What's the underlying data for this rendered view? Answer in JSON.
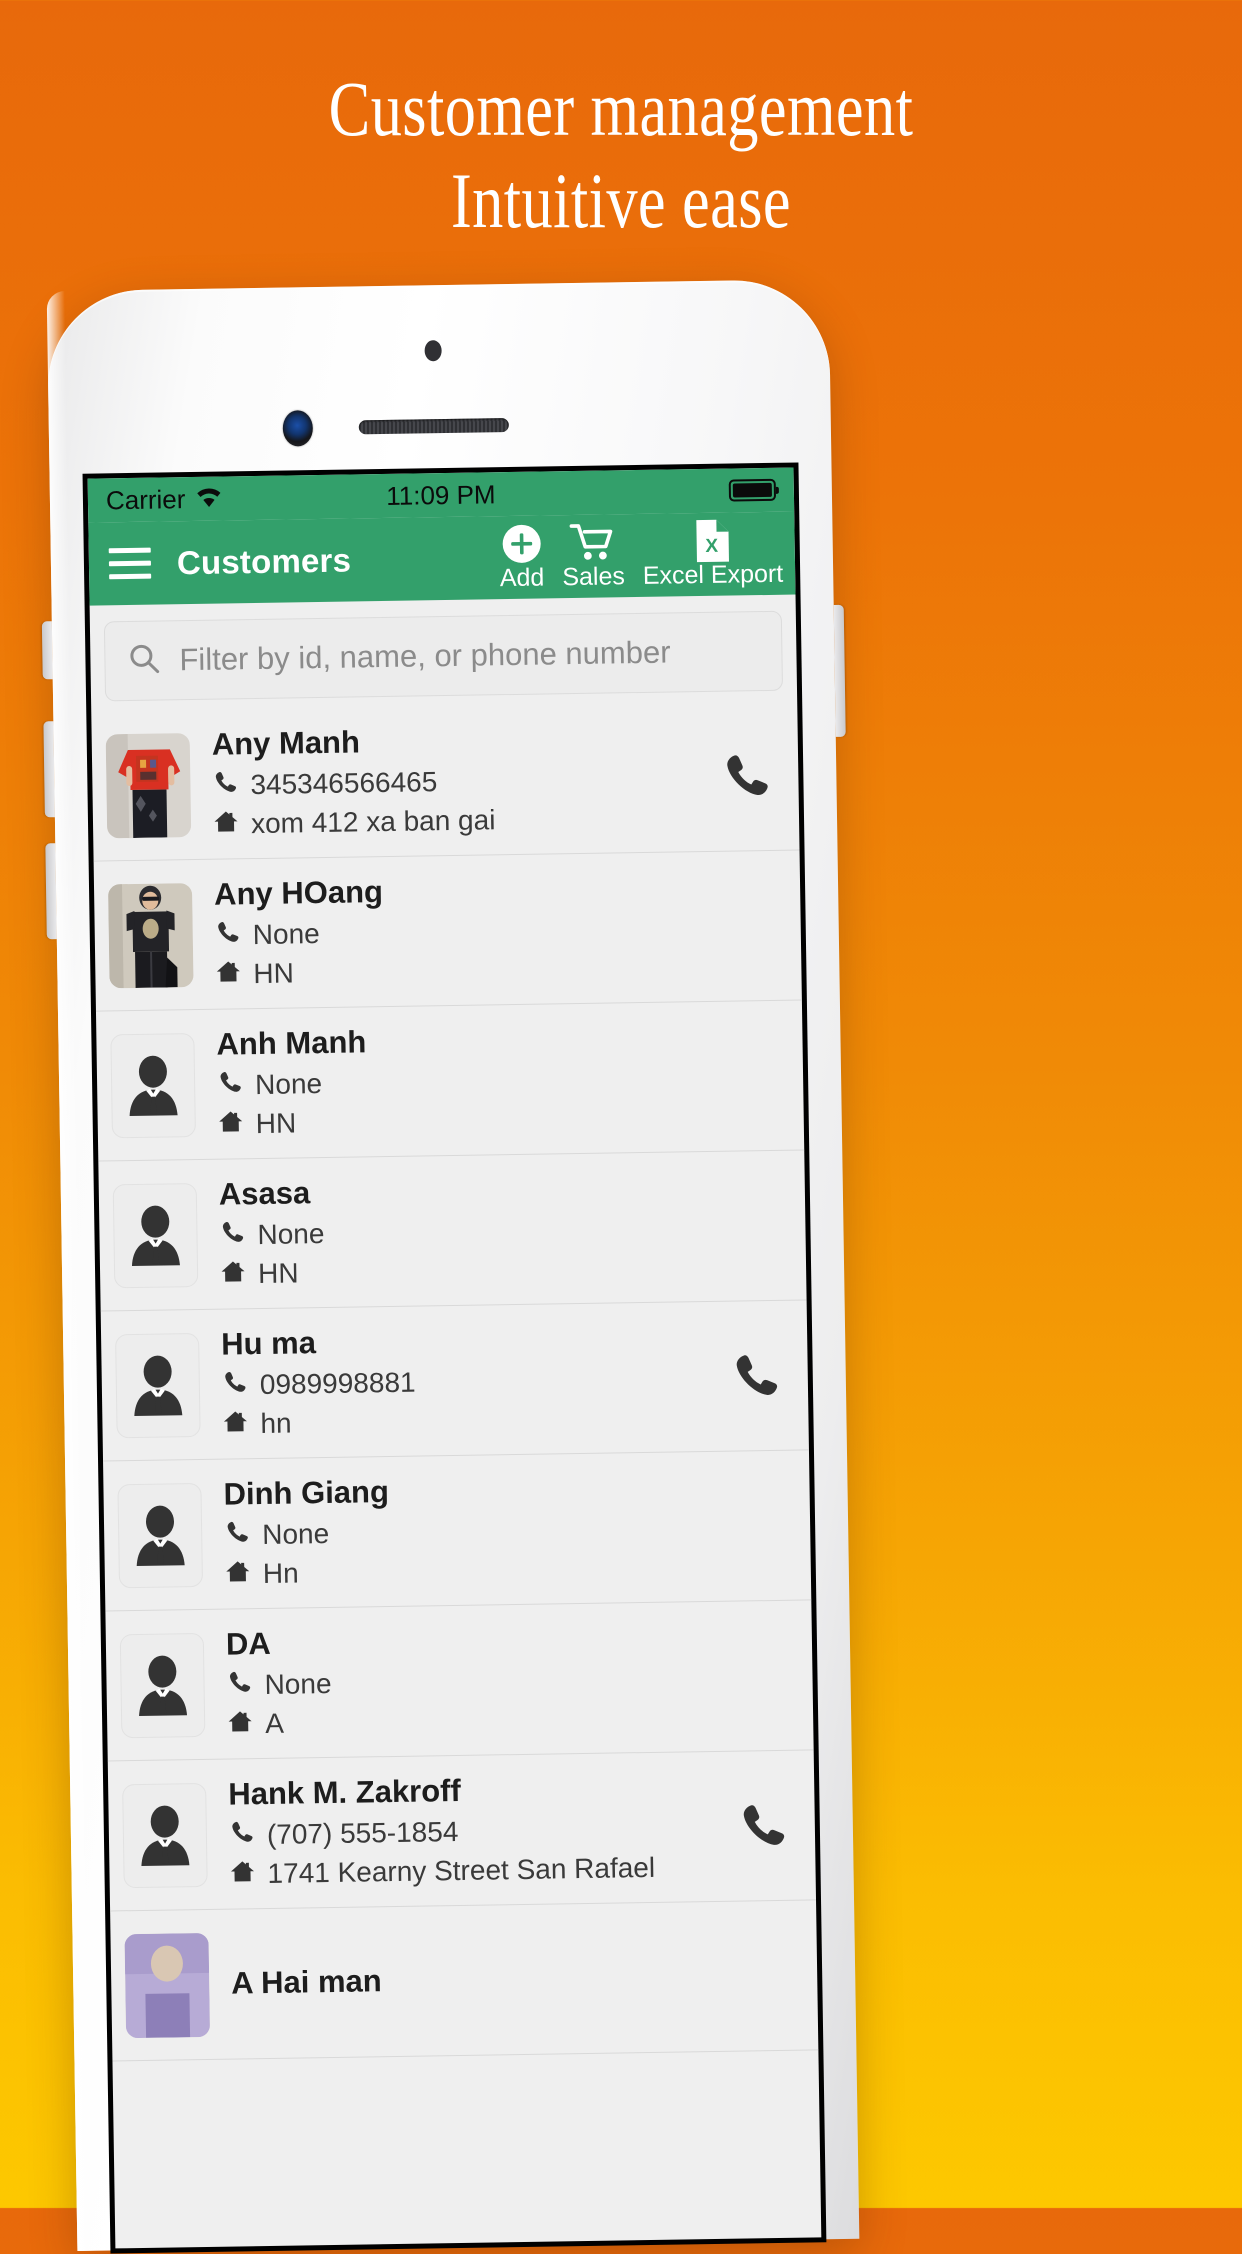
{
  "promo": {
    "line1": "Customer management",
    "line2": "Intuitive ease",
    "text_color": "#ffffff",
    "bg_top": "#e8690b",
    "bg_bottom": "#fdc800"
  },
  "status_bar": {
    "carrier": "Carrier",
    "wifi_icon": "wifi-icon",
    "time": "11:09 PM",
    "battery_icon": "battery-full-icon",
    "bg_color": "#33a06b"
  },
  "app_bar": {
    "menu_icon": "hamburger-menu-icon",
    "title": "Customers",
    "bg_color": "#33a06b",
    "actions": [
      {
        "label": "Add",
        "icon": "plus-circle-icon"
      },
      {
        "label": "Sales",
        "icon": "shopping-cart-icon"
      },
      {
        "label": "Excel Export",
        "icon": "excel-file-icon"
      }
    ]
  },
  "search": {
    "icon": "search-icon",
    "placeholder": "Filter by id, name, or phone number",
    "value": ""
  },
  "list": {
    "phone_icon": "phone-icon",
    "home_icon": "home-icon",
    "call_icon": "phone-handset-icon",
    "placeholder_avatar_icon": "businessman-avatar-icon",
    "contacts": [
      {
        "name": "Any Manh",
        "phone": "345346566465",
        "address": "xom 412 xa ban gai",
        "has_photo": true,
        "photo_style": "red-shirt-person",
        "callable": true
      },
      {
        "name": "Any HOang",
        "phone": "None",
        "address": "HN",
        "has_photo": true,
        "photo_style": "black-shirt-person",
        "callable": false
      },
      {
        "name": "Anh Manh",
        "phone": "None",
        "address": "HN",
        "has_photo": false,
        "photo_style": "",
        "callable": false
      },
      {
        "name": "Asasa",
        "phone": "None",
        "address": "HN",
        "has_photo": false,
        "photo_style": "",
        "callable": false
      },
      {
        "name": "Hu ma",
        "phone": "0989998881",
        "address": "hn",
        "has_photo": false,
        "photo_style": "",
        "callable": true
      },
      {
        "name": "Dinh Giang",
        "phone": "None",
        "address": "Hn",
        "has_photo": false,
        "photo_style": "",
        "callable": false
      },
      {
        "name": "DA",
        "phone": "None",
        "address": "A",
        "has_photo": false,
        "photo_style": "",
        "callable": false
      },
      {
        "name": "Hank M. Zakroff",
        "phone": "(707) 555-1854",
        "address": "1741 Kearny Street San Rafael",
        "has_photo": false,
        "photo_style": "",
        "callable": true
      },
      {
        "name": "A Hai man",
        "phone": "",
        "address": "",
        "has_photo": true,
        "photo_style": "purple-person",
        "callable": false
      }
    ]
  }
}
